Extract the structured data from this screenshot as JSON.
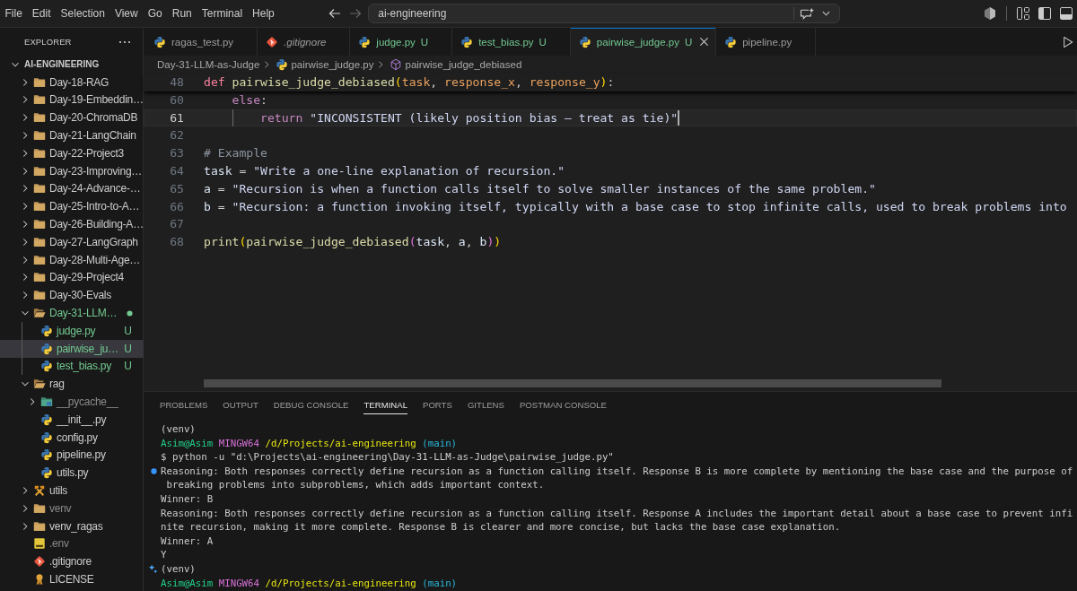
{
  "menu": [
    "File",
    "Edit",
    "Selection",
    "View",
    "Go",
    "Run",
    "Terminal",
    "Help"
  ],
  "nav": [
    {
      "kind": "back",
      "disabled": false
    },
    {
      "kind": "forward",
      "disabled": true
    }
  ],
  "command_center": {
    "text": "ai-engineering"
  },
  "sidebar": {
    "title": "EXPLORER",
    "root": {
      "label": "AI-ENGINEERING",
      "expanded": true,
      "children": [
        {
          "label": "Day-18-RAG",
          "kind": "folder",
          "expanded": false,
          "untracked": false,
          "ignored": false,
          "selected": false
        },
        {
          "label": "Day-19-Embeddin…",
          "kind": "folder",
          "expanded": false,
          "untracked": false,
          "ignored": false,
          "selected": false
        },
        {
          "label": "Day-20-ChromaDB",
          "kind": "folder",
          "expanded": false,
          "untracked": false,
          "ignored": false,
          "selected": false
        },
        {
          "label": "Day-21-LangChain",
          "kind": "folder",
          "expanded": false,
          "untracked": false,
          "ignored": false,
          "selected": false
        },
        {
          "label": "Day-22-Project3",
          "kind": "folder",
          "expanded": false,
          "untracked": false,
          "ignored": false,
          "selected": false
        },
        {
          "label": "Day-23-Improving…",
          "kind": "folder",
          "expanded": false,
          "untracked": false,
          "ignored": false,
          "selected": false
        },
        {
          "label": "Day-24-Advance-…",
          "kind": "folder",
          "expanded": false,
          "untracked": false,
          "ignored": false,
          "selected": false
        },
        {
          "label": "Day-25-Intro-to-A…",
          "kind": "folder",
          "expanded": false,
          "untracked": false,
          "ignored": false,
          "selected": false
        },
        {
          "label": "Day-26-Building-A…",
          "kind": "folder",
          "expanded": false,
          "untracked": false,
          "ignored": false,
          "selected": false
        },
        {
          "label": "Day-27-LangGraph",
          "kind": "folder",
          "expanded": false,
          "untracked": false,
          "ignored": false,
          "selected": false
        },
        {
          "label": "Day-28-Multi-Age…",
          "kind": "folder",
          "expanded": false,
          "untracked": false,
          "ignored": false,
          "selected": false
        },
        {
          "label": "Day-29-Project4",
          "kind": "folder",
          "expanded": false,
          "untracked": false,
          "ignored": false,
          "selected": false
        },
        {
          "label": "Day-30-Evals",
          "kind": "folder",
          "expanded": false,
          "untracked": false,
          "ignored": false,
          "selected": false
        },
        {
          "label": "Day-31-LLM…",
          "kind": "folder",
          "expanded": true,
          "untracked": true,
          "ignored": false,
          "selected": false,
          "children": [
            {
              "label": "judge.py",
              "kind": "python",
              "untracked": true,
              "ignored": false,
              "badge": "U",
              "selected": false
            },
            {
              "label": "pairwise_ju…",
              "kind": "python",
              "untracked": true,
              "ignored": false,
              "badge": "U",
              "selected": true
            },
            {
              "label": "test_bias.py",
              "kind": "python",
              "untracked": true,
              "ignored": false,
              "badge": "U",
              "selected": false
            }
          ]
        },
        {
          "label": "rag",
          "kind": "folder",
          "expanded": true,
          "untracked": false,
          "ignored": false,
          "selected": false,
          "children": [
            {
              "label": "__pycache__",
              "kind": "pycache",
              "expanded": false,
              "untracked": false,
              "ignored": true,
              "selected": false
            },
            {
              "label": "__init__.py",
              "kind": "python",
              "untracked": false,
              "ignored": false,
              "selected": false
            },
            {
              "label": "config.py",
              "kind": "python",
              "untracked": false,
              "ignored": false,
              "selected": false
            },
            {
              "label": "pipeline.py",
              "kind": "python",
              "untracked": false,
              "ignored": false,
              "selected": false
            },
            {
              "label": "utils.py",
              "kind": "python",
              "untracked": false,
              "ignored": false,
              "selected": false
            }
          ]
        },
        {
          "label": "utils",
          "kind": "tools",
          "expanded": false,
          "untracked": false,
          "ignored": false,
          "selected": false
        },
        {
          "label": "venv",
          "kind": "folder",
          "expanded": false,
          "untracked": false,
          "ignored": true,
          "selected": false
        },
        {
          "label": "venv_ragas",
          "kind": "folder",
          "expanded": false,
          "untracked": false,
          "ignored": false,
          "selected": false
        },
        {
          "label": ".env",
          "kind": "env",
          "untracked": false,
          "ignored": true,
          "selected": false
        },
        {
          "label": ".gitignore",
          "kind": "git",
          "untracked": false,
          "ignored": false,
          "selected": false
        },
        {
          "label": "LICENSE",
          "kind": "license",
          "untracked": false,
          "ignored": false,
          "selected": false
        }
      ]
    }
  },
  "tabs": [
    {
      "label": "ragas_test.py",
      "kind": "python",
      "untracked": false,
      "preview": false,
      "selected": false
    },
    {
      "label": ".gitignore",
      "kind": "git",
      "untracked": false,
      "preview": true,
      "selected": false
    },
    {
      "label": "judge.py",
      "kind": "python",
      "untracked": true,
      "badge": "U",
      "preview": false,
      "selected": false
    },
    {
      "label": "test_bias.py",
      "kind": "python",
      "untracked": true,
      "badge": "U",
      "preview": false,
      "selected": false
    },
    {
      "label": "pairwise_judge.py",
      "kind": "python",
      "untracked": true,
      "badge": "U",
      "preview": false,
      "selected": true
    },
    {
      "label": "pipeline.py",
      "kind": "python",
      "untracked": false,
      "preview": false,
      "selected": false
    }
  ],
  "breadcrumbs": [
    {
      "label": "Day-31-LLM-as-Judge",
      "kind": "folder"
    },
    {
      "label": "pairwise_judge.py",
      "kind": "python"
    },
    {
      "label": "pairwise_judge_debiased",
      "kind": "symbol"
    }
  ],
  "editor": {
    "sticky": [
      {
        "number": "48",
        "tokens": [
          {
            "kind": "keyword",
            "text": "def"
          },
          {
            "kind": "function",
            "text": " pairwise_judge_debiased"
          },
          {
            "kind": "paren1",
            "text": "("
          },
          {
            "kind": "param",
            "text": "task"
          },
          {
            "kind": "plain",
            "text": ", "
          },
          {
            "kind": "param",
            "text": "response_x"
          },
          {
            "kind": "plain",
            "text": ", "
          },
          {
            "kind": "param",
            "text": "response_y"
          },
          {
            "kind": "paren1",
            "text": ")"
          },
          {
            "kind": "plain",
            "text": ":"
          }
        ]
      }
    ],
    "lines": [
      {
        "number": "60",
        "current": false,
        "tokens": [
          {
            "kind": "control",
            "text": "    else"
          },
          {
            "kind": "plain",
            "text": ":"
          }
        ]
      },
      {
        "number": "61",
        "current": true,
        "tokens": [
          {
            "kind": "control",
            "text": "        return"
          },
          {
            "kind": "string",
            "text": " \"INCONSISTENT (likely position bias — treat as tie)\""
          }
        ]
      },
      {
        "number": "62",
        "current": false
      },
      {
        "number": "63",
        "current": false,
        "tokens": [
          {
            "kind": "comment",
            "text": "# Example"
          }
        ]
      },
      {
        "number": "64",
        "current": false,
        "tokens": [
          {
            "kind": "variable",
            "text": "task"
          },
          {
            "kind": "plain",
            "text": " = "
          },
          {
            "kind": "string",
            "text": "\"Write a one-line explanation of recursion.\""
          }
        ]
      },
      {
        "number": "65",
        "current": false,
        "tokens": [
          {
            "kind": "variable",
            "text": "a"
          },
          {
            "kind": "plain",
            "text": " = "
          },
          {
            "kind": "string",
            "text": "\"Recursion is when a function calls itself to solve smaller instances of the same problem.\""
          }
        ]
      },
      {
        "number": "66",
        "current": false,
        "tokens": [
          {
            "kind": "variable",
            "text": "b"
          },
          {
            "kind": "plain",
            "text": " = "
          },
          {
            "kind": "string",
            "text": "\"Recursion: a function invoking itself, typically with a base case to stop infinite calls, used to break problems into"
          }
        ]
      },
      {
        "number": "67",
        "current": false
      },
      {
        "number": "68",
        "current": false,
        "tokens": [
          {
            "kind": "function",
            "text": "print"
          },
          {
            "kind": "paren1",
            "text": "("
          },
          {
            "kind": "function",
            "text": "pairwise_judge_debiased"
          },
          {
            "kind": "paren2",
            "text": "("
          },
          {
            "kind": "variable",
            "text": "task"
          },
          {
            "kind": "plain",
            "text": ", "
          },
          {
            "kind": "variable",
            "text": "a"
          },
          {
            "kind": "plain",
            "text": ", "
          },
          {
            "kind": "variable",
            "text": "b"
          },
          {
            "kind": "paren2",
            "text": ")"
          },
          {
            "kind": "paren1",
            "text": ")"
          }
        ]
      }
    ]
  },
  "panel": {
    "tabs": [
      {
        "label": "PROBLEMS",
        "selected": false
      },
      {
        "label": "OUTPUT",
        "selected": false
      },
      {
        "label": "DEBUG CONSOLE",
        "selected": false
      },
      {
        "label": "TERMINAL",
        "selected": true
      },
      {
        "label": "PORTS",
        "selected": false
      },
      {
        "label": "GITLENS",
        "selected": false
      },
      {
        "label": "POSTMAN CONSOLE",
        "selected": false
      }
    ],
    "terminal": {
      "lines": [
        {
          "kind": "text",
          "text": "(venv)"
        },
        {
          "kind": "text",
          "segments": [
            {
              "kind": "user",
              "text": "Asim@Asim"
            },
            {
              "kind": "host",
              "text": " MINGW64"
            },
            {
              "kind": "path",
              "text": " /d/Projects/ai-engineering"
            },
            {
              "kind": "branch",
              "text": " (main)"
            }
          ]
        },
        {
          "kind": "text",
          "text": "$ python -u \"d:\\Projects\\ai-engineering\\Day-31-LLM-as-Judge\\pairwise_judge.py\""
        },
        {
          "kind": "dot-mark",
          "text": "Reasoning: Both responses correctly define recursion as a function calling itself. Response B is more complete by mentioning the base case and the purpose of"
        },
        {
          "kind": "text",
          "text": " breaking problems into subproblems, which adds important context."
        },
        {
          "kind": "text",
          "text": "Winner: B"
        },
        {
          "kind": "text",
          "text": "Reasoning: Both responses correctly define recursion as a function calling itself. Response A includes the important detail about a base case to prevent infi"
        },
        {
          "kind": "text",
          "text": "nite recursion, making it more complete. Response B is clearer and more concise, but lacks the base case explanation."
        },
        {
          "kind": "text",
          "text": "Winner: A"
        },
        {
          "kind": "text",
          "text": "Y"
        },
        {
          "kind": "sparkle-mark",
          "text": "(venv)"
        },
        {
          "kind": "text",
          "segments": [
            {
              "kind": "user",
              "text": "Asim@Asim"
            },
            {
              "kind": "host",
              "text": " MINGW64"
            },
            {
              "kind": "path",
              "text": " /d/Projects/ai-engineering"
            },
            {
              "kind": "branch",
              "text": " (main)"
            }
          ]
        }
      ]
    }
  }
}
